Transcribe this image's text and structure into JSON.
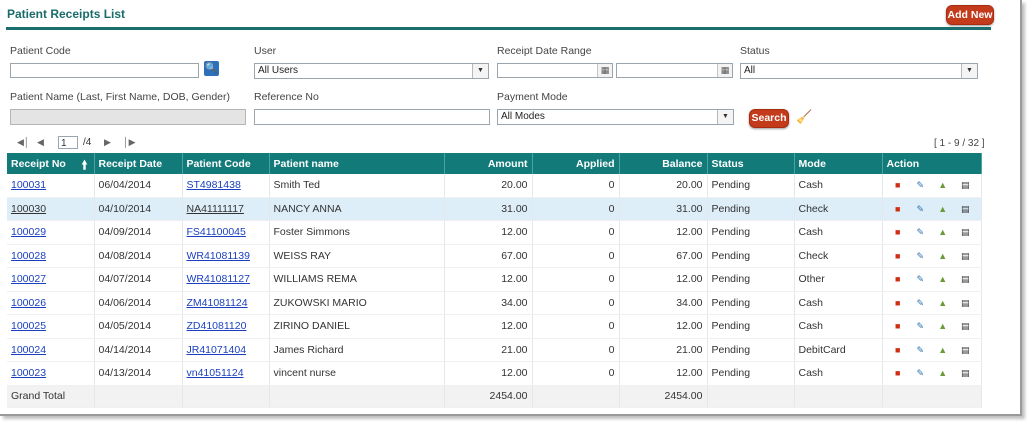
{
  "header": {
    "title": "Patient Receipts List",
    "add_new": "Add New"
  },
  "filters": {
    "patient_code_label": "Patient Code",
    "user_label": "User",
    "user_value": "All Users",
    "receipt_date_label": "Receipt Date Range",
    "status_label": "Status",
    "status_value": "All",
    "patient_name_label": "Patient Name (Last, First Name, DOB, Gender)",
    "reference_label": "Reference No",
    "payment_mode_label": "Payment Mode",
    "payment_mode_value": "All Modes",
    "search_label": "Search"
  },
  "pager": {
    "page": "1",
    "of": "/4",
    "range": "[ 1 - 9 / 32 ]"
  },
  "grid": {
    "columns": [
      "Receipt No",
      "Receipt Date",
      "Patient Code",
      "Patient name",
      "Amount",
      "Applied",
      "Balance",
      "Status",
      "Mode",
      "Action"
    ],
    "rows": [
      {
        "receipt_no": "100031",
        "date": "06/04/2014",
        "code": "ST4981438",
        "name": "Smith Ted",
        "amount": "20.00",
        "applied": "0",
        "balance": "20.00",
        "status": "Pending",
        "mode": "Cash"
      },
      {
        "receipt_no": "100030",
        "date": "04/10/2014",
        "code": "NA41111117",
        "name": "NANCY ANNA",
        "amount": "31.00",
        "applied": "0",
        "balance": "31.00",
        "status": "Pending",
        "mode": "Check"
      },
      {
        "receipt_no": "100029",
        "date": "04/09/2014",
        "code": "FS41100045",
        "name": "Foster Simmons",
        "amount": "12.00",
        "applied": "0",
        "balance": "12.00",
        "status": "Pending",
        "mode": "Cash"
      },
      {
        "receipt_no": "100028",
        "date": "04/08/2014",
        "code": "WR41081139",
        "name": "WEISS RAY",
        "amount": "67.00",
        "applied": "0",
        "balance": "67.00",
        "status": "Pending",
        "mode": "Check"
      },
      {
        "receipt_no": "100027",
        "date": "04/07/2014",
        "code": "WR41081127",
        "name": "WILLIAMS REMA",
        "amount": "12.00",
        "applied": "0",
        "balance": "12.00",
        "status": "Pending",
        "mode": "Other"
      },
      {
        "receipt_no": "100026",
        "date": "04/06/2014",
        "code": "ZM41081124",
        "name": "ZUKOWSKI MARIO",
        "amount": "34.00",
        "applied": "0",
        "balance": "34.00",
        "status": "Pending",
        "mode": "Cash"
      },
      {
        "receipt_no": "100025",
        "date": "04/05/2014",
        "code": "ZD41081120",
        "name": "ZIRINO DANIEL",
        "amount": "12.00",
        "applied": "0",
        "balance": "12.00",
        "status": "Pending",
        "mode": "Cash"
      },
      {
        "receipt_no": "100024",
        "date": "04/14/2014",
        "code": "JR41071404",
        "name": "James Richard",
        "amount": "21.00",
        "applied": "0",
        "balance": "21.00",
        "status": "Pending",
        "mode": "DebitCard"
      },
      {
        "receipt_no": "100023",
        "date": "04/13/2014",
        "code": "vn41051124",
        "name": "vincent nurse",
        "amount": "12.00",
        "applied": "0",
        "balance": "12.00",
        "status": "Pending",
        "mode": "Cash"
      }
    ],
    "total": {
      "label": "Grand Total",
      "amount": "2454.00",
      "balance": "2454.00"
    }
  },
  "icons": [
    "search-icon",
    "broom-icon",
    "calendar-icon",
    "delete-icon",
    "edit-icon",
    "print-icon",
    "document-icon",
    "sort-ascending-icon"
  ],
  "colors": {
    "accent": "#137a7a",
    "button": "#c43b1c",
    "link": "#1a3fbf",
    "highlight": "#deeef8"
  }
}
